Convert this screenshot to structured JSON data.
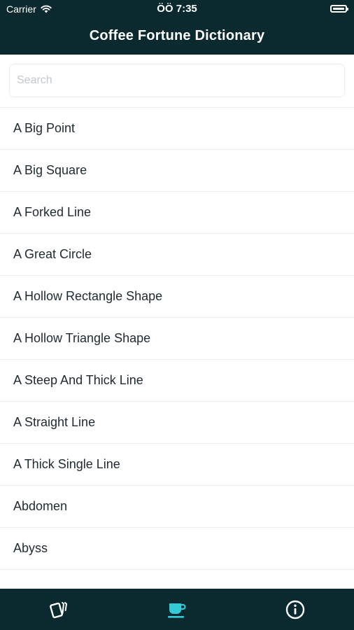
{
  "status_bar": {
    "carrier": "Carrier",
    "time": "ÖÖ 7:35"
  },
  "header": {
    "title": "Coffee Fortune Dictionary"
  },
  "search": {
    "placeholder": "Search",
    "value": ""
  },
  "list": {
    "items": [
      "A Big Point",
      "A Big Square",
      "A Forked Line",
      "A Great Circle",
      "A Hollow Rectangle Shape",
      "A Hollow Triangle Shape",
      "A Steep And Thick Line",
      "A Straight Line",
      "A Thick Single Line",
      "Abdomen",
      "Abyss"
    ]
  },
  "tab_bar": {
    "tabs": [
      {
        "icon": "cards-icon",
        "active": false
      },
      {
        "icon": "coffee-cup-icon",
        "active": true
      },
      {
        "icon": "info-icon",
        "active": false
      }
    ]
  },
  "colors": {
    "header_bg": "#0a2a2f",
    "tab_active": "#35c9d6",
    "tab_inactive": "#ffffff",
    "text": "#1e2a30"
  }
}
